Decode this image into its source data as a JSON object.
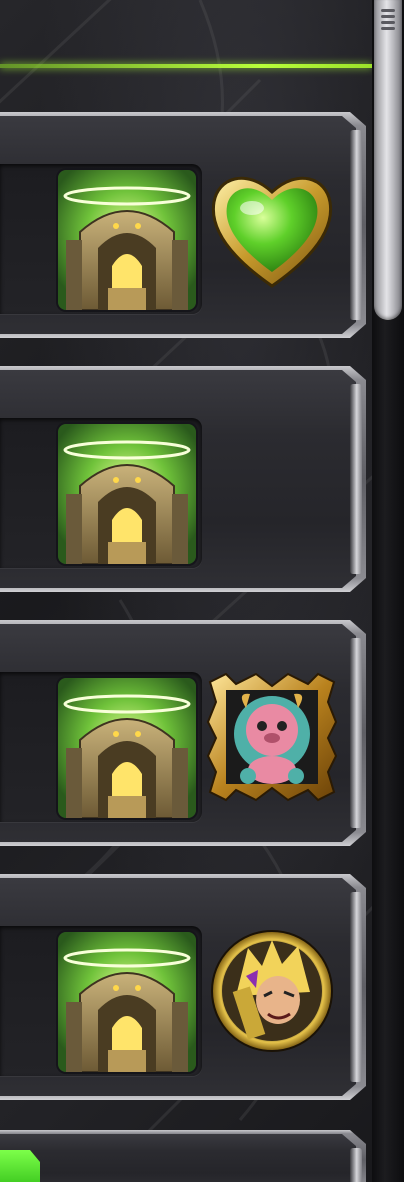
{
  "screen": {
    "accent_color": "#b8ff3a",
    "panel_color": "#2b2b30"
  },
  "scrollbar": {
    "grip_icon": "scroll-grip"
  },
  "quest_rows": [
    {
      "thumbnail": "temple-gate",
      "reward": "green-heart"
    },
    {
      "thumbnail": "temple-gate",
      "reward": ""
    },
    {
      "thumbnail": "temple-gate",
      "reward": "pink-bear-monster-frame"
    },
    {
      "thumbnail": "temple-gate",
      "reward": "blonde-warrior-medallion"
    }
  ],
  "bottom": {
    "partial_row_visible": true,
    "tab_color": "#52d92a"
  }
}
